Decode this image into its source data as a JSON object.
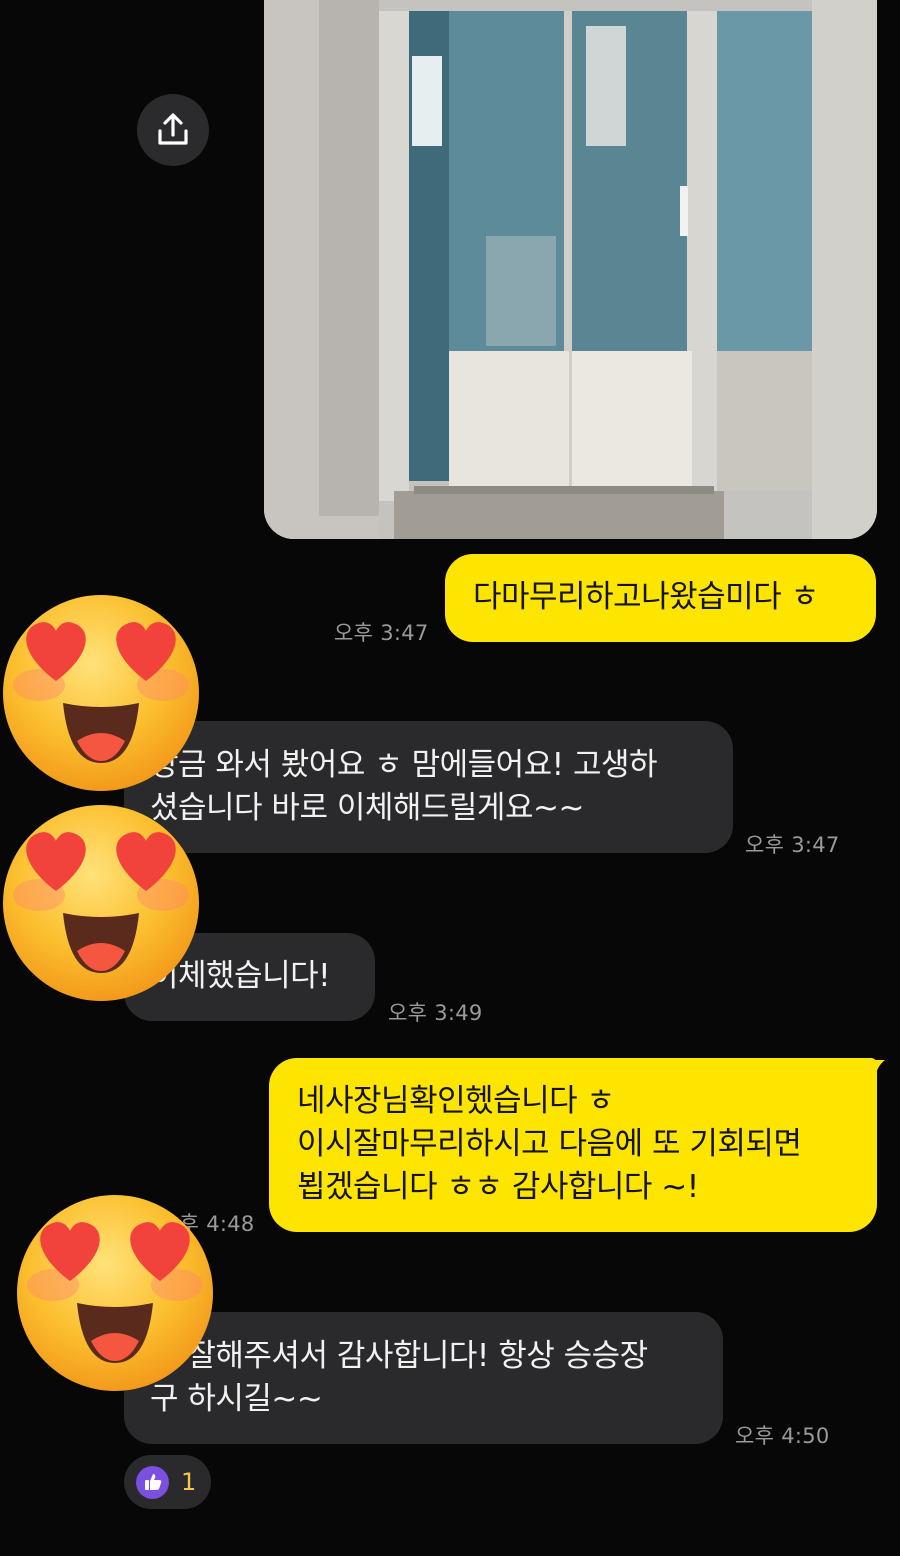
{
  "chat": {
    "photo_share_icon": "share-upload-icon",
    "messages": [
      {
        "id": "m1",
        "side": "mine",
        "lines": [
          "다마무리하고나왔습미다 ㅎ"
        ],
        "time": "오후 3:47"
      },
      {
        "id": "m2",
        "side": "theirs",
        "lines": [
          "방금 와서 봤어요 ㅎ 맘에들어요! 고생하",
          "셨습니다 바로 이체해드릴게요~~"
        ],
        "time": "오후 3:47"
      },
      {
        "id": "m3",
        "side": "theirs",
        "lines": [
          "이체했습니다!"
        ],
        "time": "오후 3:49"
      },
      {
        "id": "m4",
        "side": "mine",
        "lines": [
          "네사장님확인헸습니다 ㅎ",
          "이시잘마무리하시고 다음에 또 기회되면",
          "뵙겠습니다 ㅎㅎ 감사합니다 ~!"
        ],
        "time": "오후 4:48"
      },
      {
        "id": "m5",
        "side": "theirs",
        "lines": [
          "넘 잘해주셔서 감사합니다! 항상 승승장",
          "구 하시길~~"
        ],
        "time": "오후 4:50"
      }
    ],
    "reaction": {
      "icon": "thumbs-up-icon",
      "count": "1"
    }
  },
  "colors": {
    "background": "#070707",
    "my_bubble": "#fee500",
    "their_bubble": "#2a2a2c",
    "timestamp": "#9a9a9a",
    "reaction_icon": "#7b4fe0",
    "reaction_count": "#f3c74a"
  },
  "overlay_stickers": [
    "heart-eyes-emoji",
    "heart-eyes-emoji",
    "heart-eyes-emoji"
  ]
}
